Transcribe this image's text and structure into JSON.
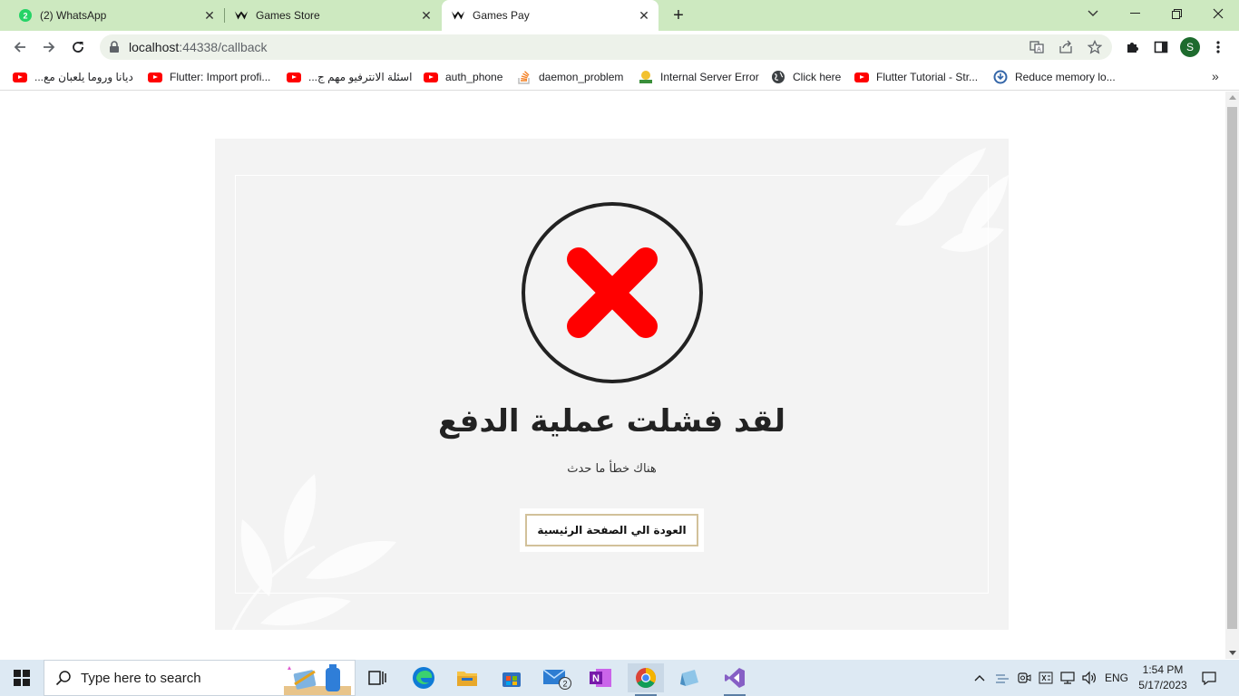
{
  "browser": {
    "tabs": [
      {
        "title": "(2) WhatsApp",
        "badge": "2",
        "active": false
      },
      {
        "title": "Games Store",
        "active": false
      },
      {
        "title": "Games Pay",
        "active": true
      }
    ],
    "url_host": "localhost",
    "url_path": ":44338/callback",
    "profile_initial": "S",
    "bookmarks": [
      {
        "label": "ديانا وروما يلعبان مع...",
        "icon": "youtube-icon"
      },
      {
        "label": "Flutter: Import profi...",
        "icon": "youtube-icon"
      },
      {
        "label": "اسئلة الانترفيو مهم ج...",
        "icon": "youtube-icon"
      },
      {
        "label": "auth_phone",
        "icon": "youtube-icon"
      },
      {
        "label": "daemon_problem",
        "icon": "stackoverflow-icon"
      },
      {
        "label": "Internal Server Error",
        "icon": "site-icon"
      },
      {
        "label": "Click here",
        "icon": "globe-icon"
      },
      {
        "label": "Flutter Tutorial - Str...",
        "icon": "youtube-icon"
      },
      {
        "label": "Reduce memory lo...",
        "icon": "shield-icon"
      }
    ]
  },
  "page": {
    "title": "لقد فشلت عملية الدفع",
    "subtitle": "هناك خطأ ما حدث",
    "home_button": "العودة الي الصفحة الرئيسية",
    "colors": {
      "cross": "#ff0000",
      "circle": "#222222",
      "card": "#f3f3f3",
      "button_border": "#d2c19a"
    }
  },
  "taskbar": {
    "search_placeholder": "Type here to search",
    "language": "ENG",
    "time": "1:54 PM",
    "date": "5/17/2023",
    "mail_badge": "2"
  }
}
